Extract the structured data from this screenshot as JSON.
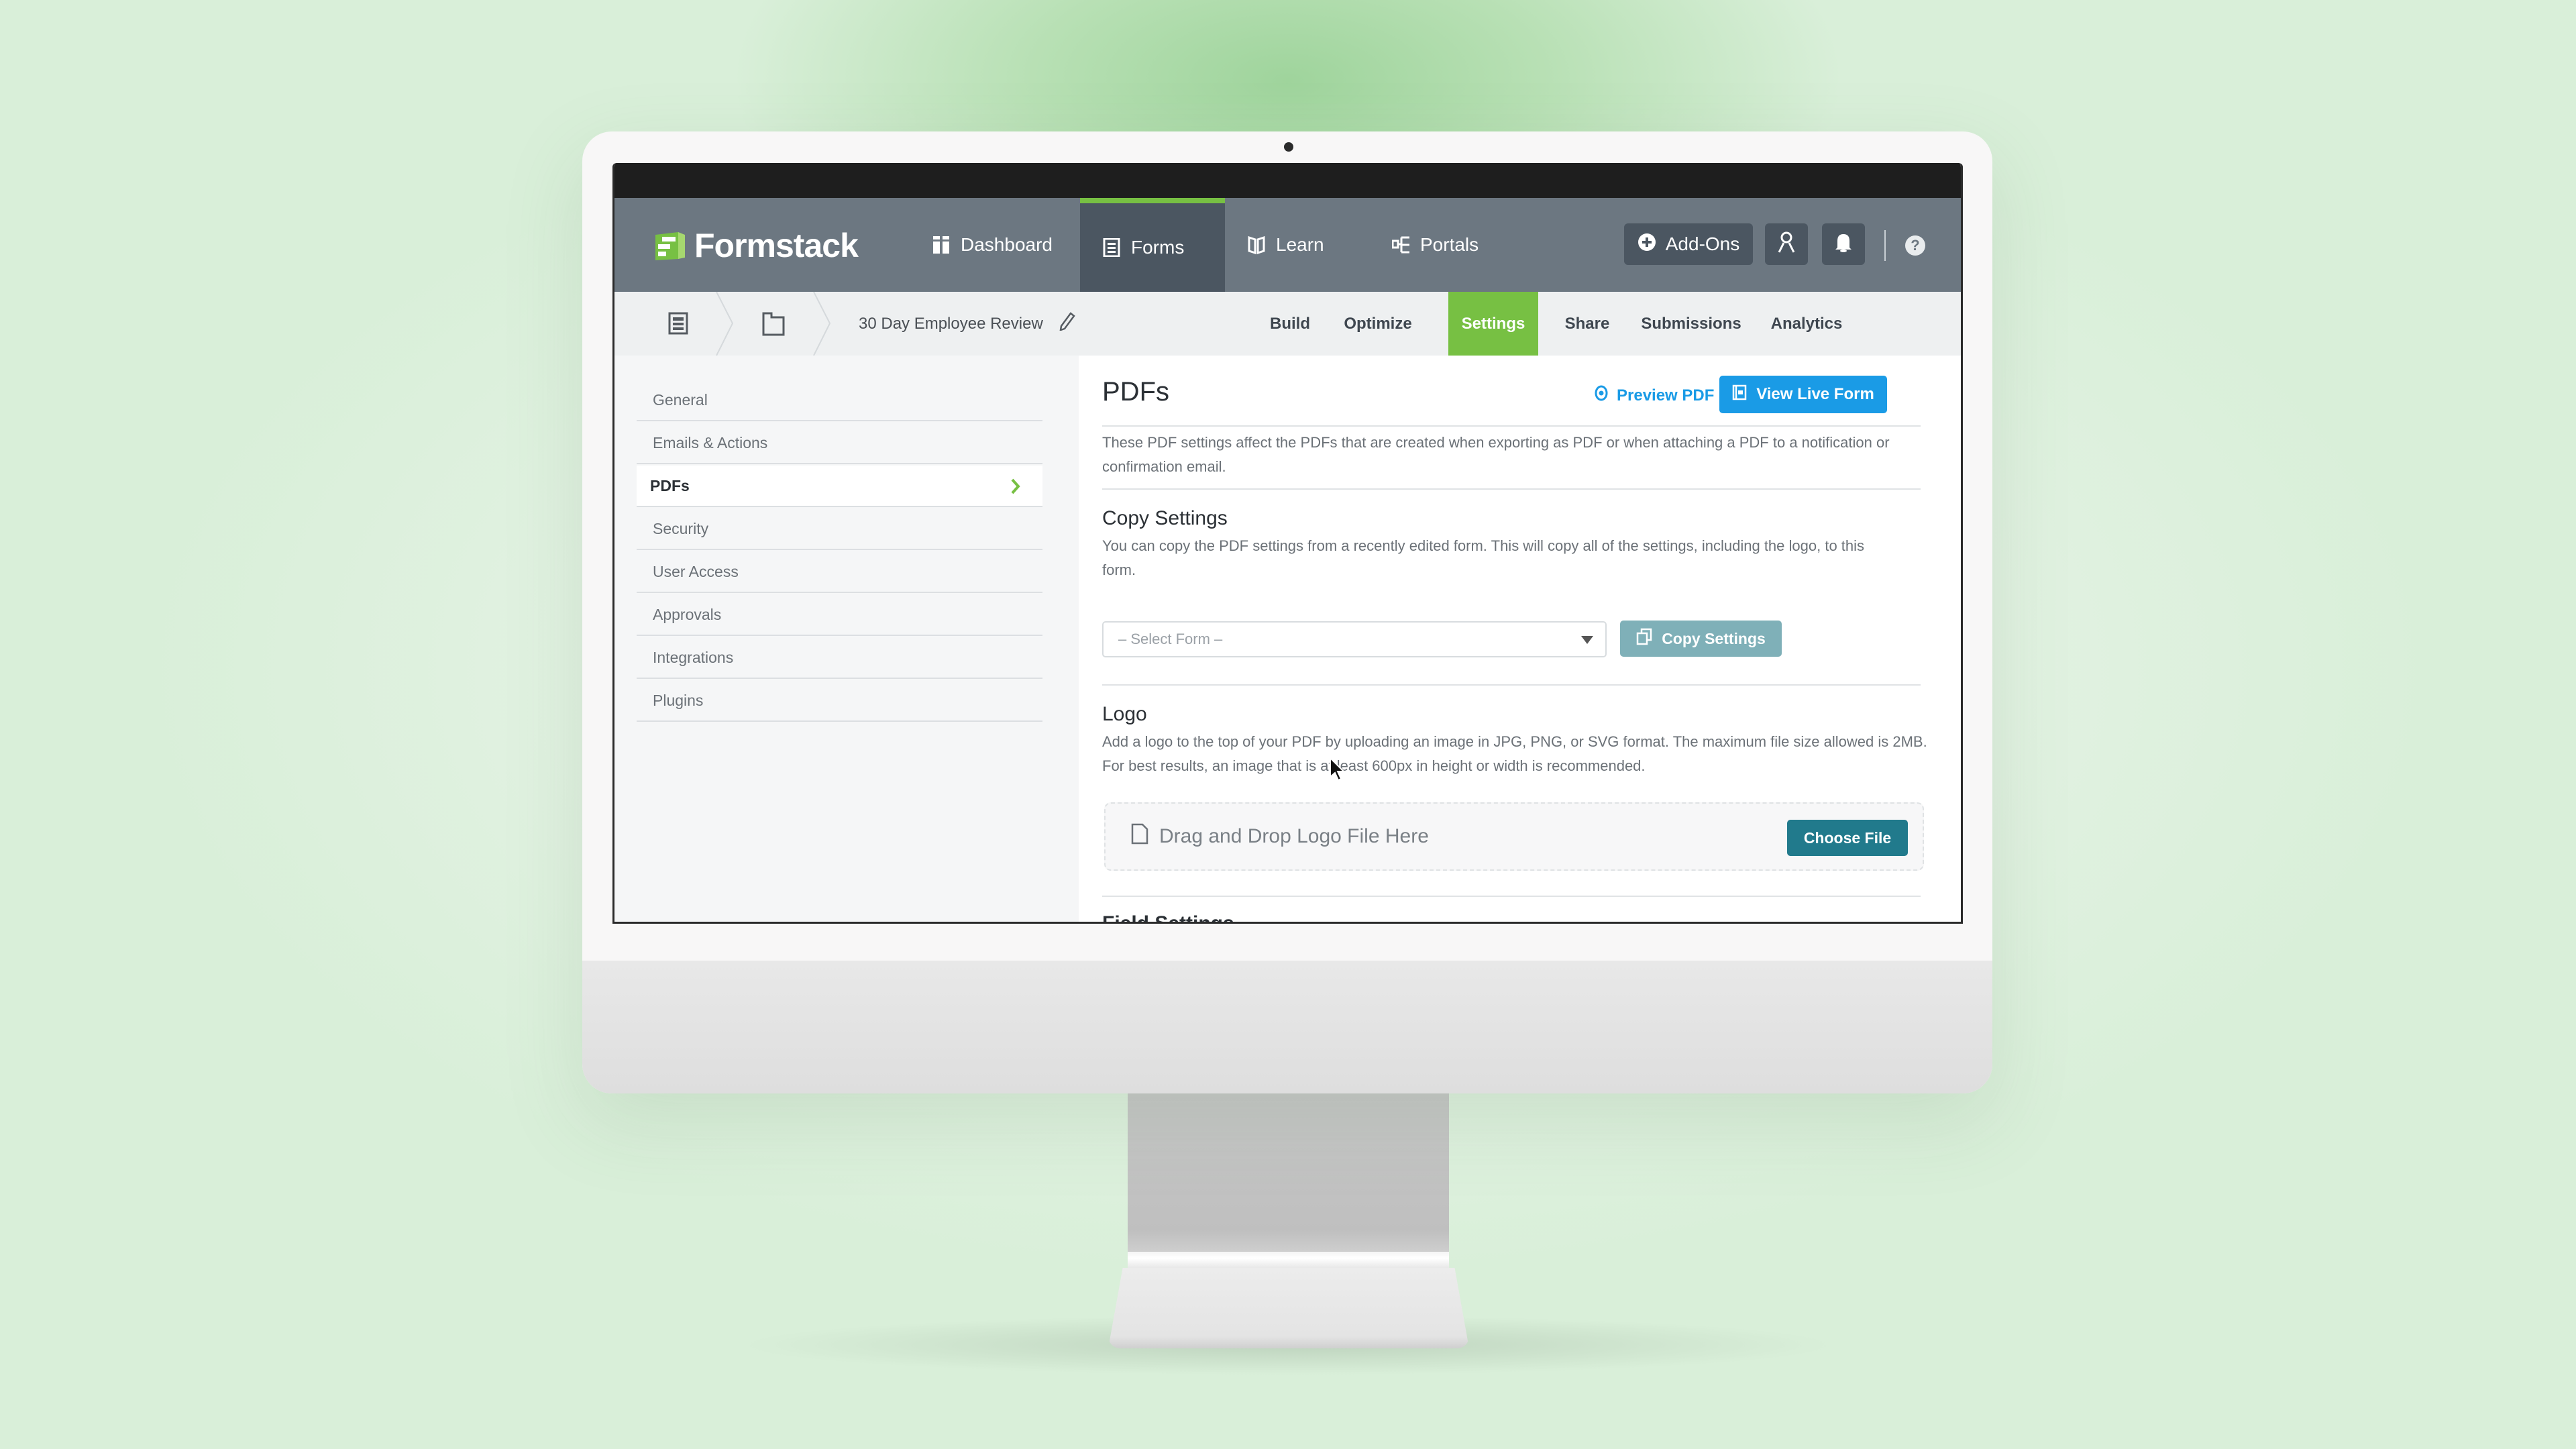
{
  "app": {
    "brand": "Formstack",
    "colors": {
      "accent_green": "#77c043",
      "header_gray": "#6c7781",
      "header_active": "#4b5661",
      "link_blue": "#1a9be6",
      "copy_button": "#7fb0b8",
      "choose_file": "#217a8c"
    }
  },
  "header": {
    "nav": [
      {
        "label": "Dashboard",
        "icon": "dashboard-icon"
      },
      {
        "label": "Forms",
        "icon": "forms-icon",
        "active": true
      },
      {
        "label": "Learn",
        "icon": "book-icon"
      },
      {
        "label": "Portals",
        "icon": "portals-icon"
      }
    ],
    "addons_label": "Add-Ons",
    "help_glyph": "?"
  },
  "subnav": {
    "form_name": "30 Day Employee Review",
    "tabs": [
      {
        "label": "Build"
      },
      {
        "label": "Optimize"
      },
      {
        "label": "Settings",
        "active": true
      },
      {
        "label": "Share"
      },
      {
        "label": "Submissions"
      },
      {
        "label": "Analytics"
      }
    ]
  },
  "sidebar": {
    "items": [
      {
        "label": "General"
      },
      {
        "label": "Emails & Actions"
      },
      {
        "label": "PDFs",
        "active": true
      },
      {
        "label": "Security"
      },
      {
        "label": "User Access"
      },
      {
        "label": "Approvals"
      },
      {
        "label": "Integrations"
      },
      {
        "label": "Plugins"
      }
    ]
  },
  "main": {
    "title": "PDFs",
    "preview_label": "Preview PDF",
    "view_live_label": "View Live Form",
    "intro": "These PDF settings affect the PDFs that are created when exporting as PDF or when attaching a PDF to a notification or confirmation email.",
    "copy": {
      "heading": "Copy Settings",
      "description": "You can copy the PDF settings from a recently edited form. This will copy all of the settings, including the logo, to this form.",
      "select_placeholder": "– Select Form –",
      "button_label": "Copy Settings"
    },
    "logo": {
      "heading": "Logo",
      "description": "Add a logo to the top of your PDF by uploading an image in JPG, PNG, or SVG format. The maximum file size allowed is 2MB. For best results, an image that is at least 600px in height or width is recommended.",
      "dropzone_label": "Drag and Drop Logo File Here",
      "choose_label": "Choose File"
    },
    "next_heading": "Field Settings"
  }
}
